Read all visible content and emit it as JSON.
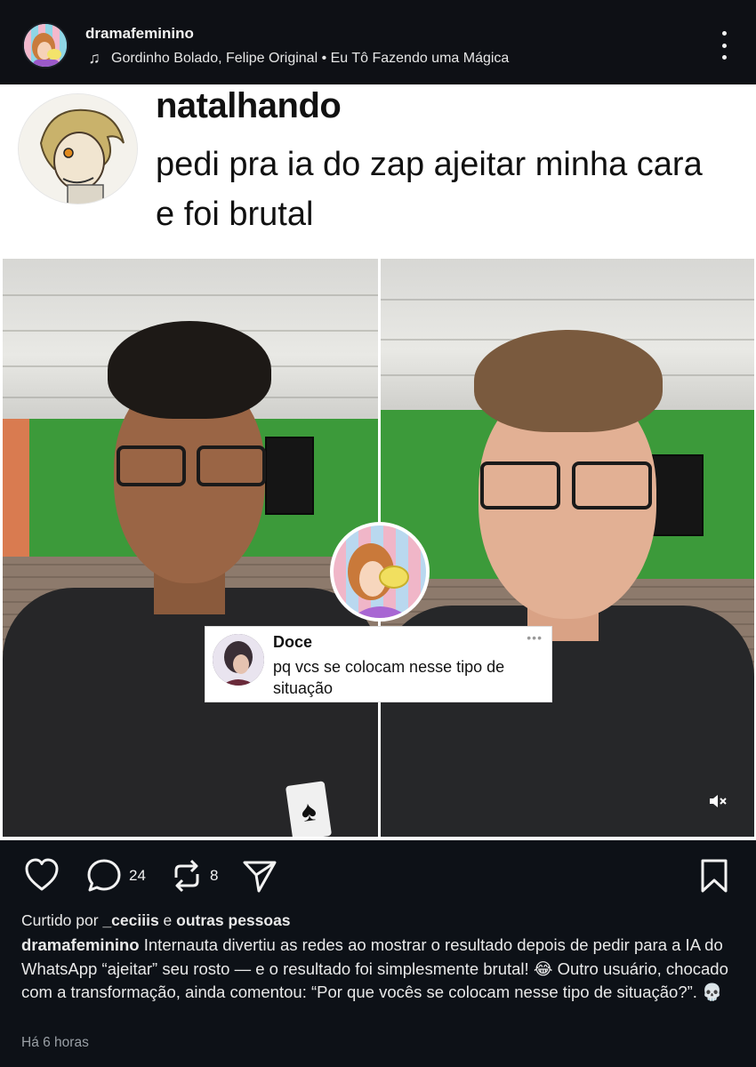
{
  "header": {
    "username": "dramafeminino",
    "music_label": "Gordinho Bolado, Felipe Original • Eu Tô Fazendo uma Mágica",
    "music_icon": "music-note-icon",
    "more_icon": "more-vertical-icon"
  },
  "tweet": {
    "name": "natalhando",
    "text": "pedi pra ia do zap ajeitar minha cara e foi brutal"
  },
  "comment": {
    "name": "Doce",
    "text": "pq vcs se colocam nesse tipo de situação",
    "dots": "•••"
  },
  "actions": {
    "like_icon": "heart-icon",
    "comment_icon": "comment-bubble-icon",
    "comment_count": "24",
    "repost_icon": "repost-icon",
    "repost_count": "8",
    "share_icon": "send-icon",
    "save_icon": "bookmark-icon"
  },
  "liked_by": {
    "prefix": "Curtido por ",
    "user": "_ceciiis",
    "middle": " e ",
    "others": "outras pessoas"
  },
  "caption": {
    "user": "dramafeminino",
    "text": " Internauta divertiu as redes ao mostrar o resultado depois de pedir para a IA do WhatsApp “ajeitar” seu rosto — e o resultado foi simplesmente brutal! 😂 Outro usuário, chocado com a transformação, ainda comentou: “Por que vocês se colocam nesse tipo de situação?”. 💀"
  },
  "timestamp": "Há 6 horas",
  "media": {
    "mute_icon": "volume-muted-icon"
  },
  "colors": {
    "background": "#0d1117",
    "wall_green": "#3c9a3a",
    "text": "#f5f5f5",
    "muted_text": "#9aa0a6"
  }
}
